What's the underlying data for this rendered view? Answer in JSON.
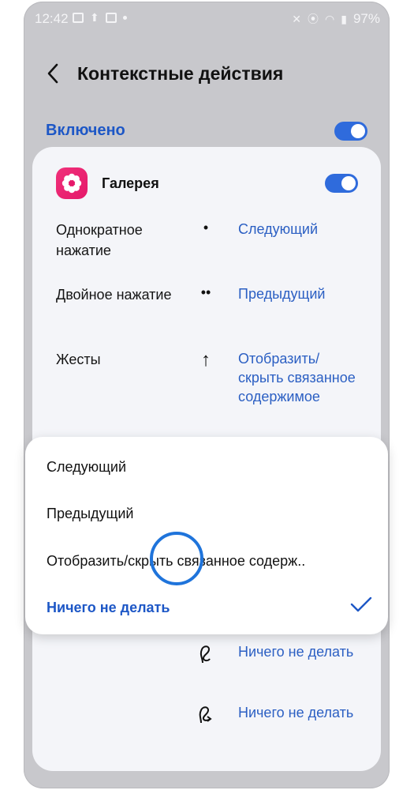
{
  "status_bar": {
    "time": "12:42",
    "battery": "97%",
    "left_icons": [
      "image-icon",
      "upload-icon",
      "app-notification-icon",
      "dot-icon"
    ],
    "right_icons": [
      "mute-icon",
      "location-icon",
      "wifi-icon",
      "signal-icon"
    ]
  },
  "header": {
    "title": "Контекстные действия"
  },
  "master_switch": {
    "label": "Включено",
    "on": true
  },
  "app": {
    "name": "Галерея",
    "icon": "flower-icon",
    "on": true
  },
  "actions": [
    {
      "label": "Однократное нажатие",
      "symbol": "•",
      "value": "Следующий"
    },
    {
      "label": "Двойное нажатие",
      "symbol": "••",
      "value": "Предыдущий"
    },
    {
      "label": "Жесты",
      "symbol": "↑",
      "value": "Отобразить/ скрыть связанное содержимое"
    },
    {
      "label": "",
      "symbol": "gesture-loop-icon",
      "value": "Ничего не делать"
    },
    {
      "label": "",
      "symbol": "gesture-loop-right-icon",
      "value": "Ничего не делать"
    }
  ],
  "popup": {
    "options": [
      "Следующий",
      "Предыдущий",
      "Отобразить/скрыть связанное содерж..",
      "Ничего не делать"
    ],
    "selected_index": 3
  },
  "colors": {
    "accent": "#1d57c6",
    "toggle": "#2f6bdc",
    "app_icon": "#e91e63",
    "touch_indicator": "#1f74db"
  }
}
